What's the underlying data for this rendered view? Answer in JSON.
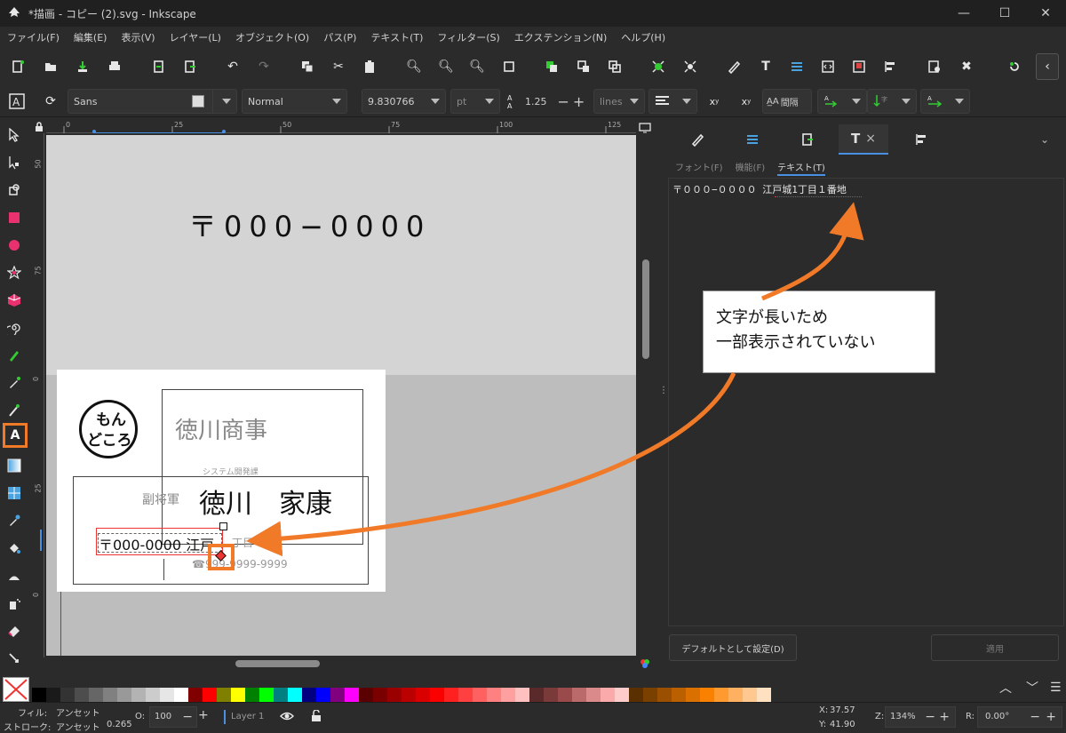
{
  "window": {
    "title": "*描画 - コピー (2).svg - Inkscape",
    "minimize": "—",
    "maximize": "☐",
    "close": "✕"
  },
  "menu": [
    "ファイル(F)",
    "編集(E)",
    "表示(V)",
    "レイヤー(L)",
    "オブジェクト(O)",
    "パス(P)",
    "テキスト(T)",
    "フィルター(S)",
    "エクステンション(N)",
    "ヘルプ(H)"
  ],
  "text_toolbar": {
    "font_family": "Sans",
    "font_style": "Normal",
    "font_size": "9.830766",
    "unit": "pt",
    "line_spacing": "1.25",
    "spacing_unit": "lines",
    "vertical_label": "間隔",
    "minus": "−",
    "plus": "+"
  },
  "ruler": {
    "h_labels": [
      "0",
      "25",
      "50",
      "75",
      "100",
      "125"
    ],
    "v_labels": [
      "50",
      "75",
      "0",
      "25",
      "0"
    ]
  },
  "canvas": {
    "postal_big": "〒000−0000",
    "card": {
      "logo_line1": "もん",
      "logo_line2": "どころ",
      "company": "徳川商事",
      "department": "システム開発課",
      "title": "副将軍",
      "name": "徳川　家康",
      "address_visible": "〒000-0000 江戸",
      "address_ghost": "丁目",
      "phone": "☎999-9999-9999"
    }
  },
  "panel": {
    "tabs": [
      "fill-stroke",
      "xml-editor",
      "document",
      "text",
      "align"
    ],
    "active_tab_close": "×",
    "subtabs": [
      "フォント(F)",
      "機能(F)",
      "テキスト(T)"
    ],
    "active_subtab": "テキスト(T)",
    "text_content": "〒０００−００００ 江戸城1丁目１番地",
    "default_button": "デフォルトとして設定(D)",
    "apply_button": "適用"
  },
  "callout": {
    "line1": "文字が長いため",
    "line2": "一部表示されていない"
  },
  "status": {
    "fill_label": "フィル:",
    "fill_value": "アンセット",
    "stroke_label": "ストローク:",
    "stroke_value": "アンセット",
    "stroke_width": "0.265",
    "opacity_label": "O:",
    "opacity_value": "100",
    "layer": "Layer 1",
    "x_label": "X:",
    "x_value": "37.57",
    "y_label": "Y:",
    "y_value": "41.90",
    "zoom_label": "Z:",
    "zoom_value": "134%",
    "rotate_label": "R:",
    "rotate_value": "0.00°"
  },
  "colors": {
    "accent": "#f07a28",
    "selection_blue": "#4a90e2"
  }
}
